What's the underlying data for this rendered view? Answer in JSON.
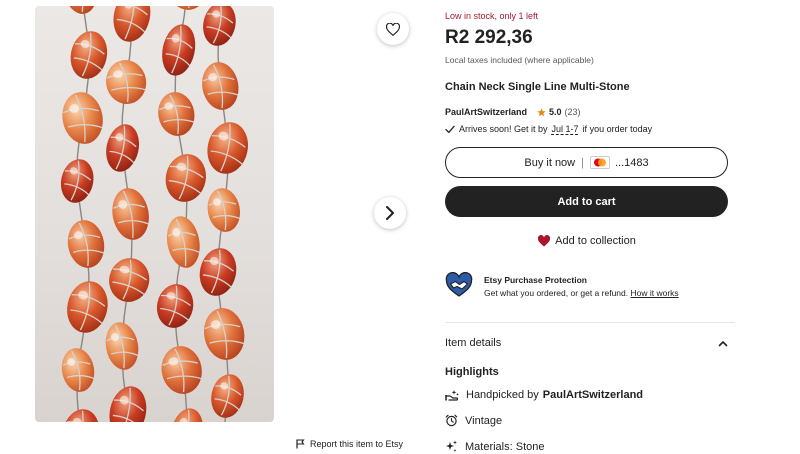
{
  "gallery": {
    "favorite_icon": "heart-outline-icon",
    "next_icon": "chevron-right-icon",
    "report_icon": "flag-icon",
    "report_label": "Report this item to Etsy"
  },
  "listing": {
    "stock_text": "Low in stock, only 1 left",
    "price": "R2 292,36",
    "tax_note": "Local taxes included (where applicable)",
    "title": "Chain Neck Single Line Multi-Stone",
    "seller_name": "PaulArtSwitzerland",
    "rating": "5.0",
    "review_count": "(23)",
    "arrival_prefix": "Arrives soon! Get it by",
    "arrival_dates": "Jul 1-7",
    "arrival_suffix": "if you order today"
  },
  "actions": {
    "buy_now_label": "Buy it now",
    "buy_now_separator": "|",
    "card_digits": "...1483",
    "add_to_cart_label": "Add to cart",
    "add_to_collection_label": "Add to collection"
  },
  "protection": {
    "title": "Etsy Purchase Protection",
    "description": "Get what you ordered, or get a refund.",
    "link_label": "How it works"
  },
  "details": {
    "header": "Item details",
    "highlights_title": "Highlights",
    "handpicked_prefix": "Handpicked by",
    "handpicked_shop": "PaulArtSwitzerland",
    "vintage_label": "Vintage",
    "materials_label": "Materials: Stone"
  },
  "colors": {
    "stock_red": "#a61a2e",
    "button_dark": "#222222",
    "heart_red": "#a8172d",
    "star": "#e08a14",
    "protection_blue": "#2d5ba8"
  }
}
